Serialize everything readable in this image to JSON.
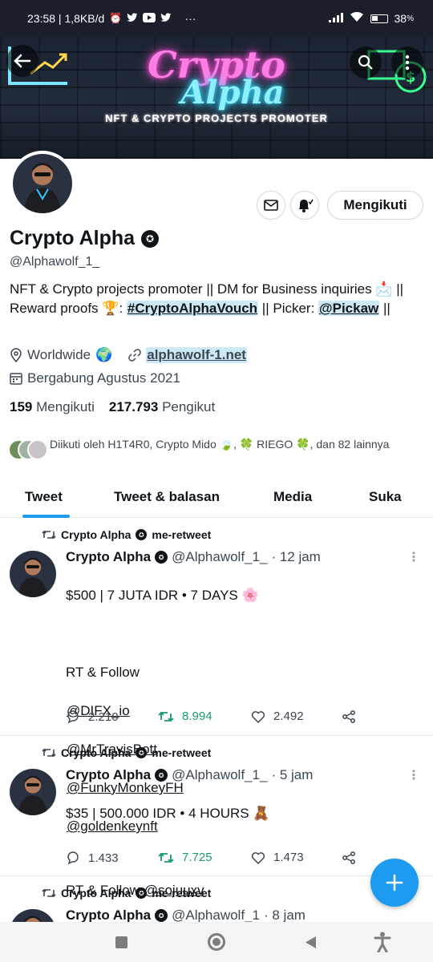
{
  "status_bar": {
    "time_info": "23:58 | 1,8KB/d",
    "more": "···",
    "battery": "38"
  },
  "banner": {
    "title_line1": "Crypto",
    "title_line2": "Alpha",
    "subtitle": "NFT & CRYPTO PROJECTS PROMOTER"
  },
  "profile": {
    "name": "Crypto Alpha",
    "handle": "@Alphawolf_1_",
    "follow_button": "Mengikuti",
    "bio_part1": "NFT & Crypto projects promoter || DM for Business inquiries",
    "bio_emoji1": "📩",
    "bio_part2": "|| Reward proofs",
    "bio_emoji2": "🏆",
    "bio_hashtag": "#CryptoAlphaVouch",
    "bio_part3": "|| Picker:",
    "bio_mention": "@Pickaw",
    "bio_part4": "||",
    "location": "Worldwide",
    "location_emoji": "🌍",
    "website": "alphawolf-1.net",
    "joined": "Bergabung Agustus 2021",
    "following_count": "159",
    "following_label": "Mengikuti",
    "followers_count": "217.793",
    "followers_label": "Pengikut",
    "followed_by": "Diikuti oleh H1T4R0, Crypto Mido 🍃, 🍀 RIEGO 🍀, dan 82 lainnya"
  },
  "tabs": [
    "Tweet",
    "Tweet & balasan",
    "Media",
    "Suka"
  ],
  "tweets": [
    {
      "retweeted_by": "Crypto Alpha",
      "retweet_label": "me-retweet",
      "name": "Crypto Alpha",
      "handle": "@Alphawolf_1_",
      "time": "· 12 jam",
      "line1": "$500 | 7 JUTA IDR • 7 DAYS 🌸",
      "line2": "RT & Follow",
      "mentions": [
        "@DIFX_io",
        "@MrTravisBott",
        "@FunkyMonkeyFH",
        "@goldenkeynft"
      ],
      "replies": "2.210",
      "retweets": "8.994",
      "likes": "2.492"
    },
    {
      "retweeted_by": "Crypto Alpha",
      "retweet_label": "me-retweet",
      "name": "Crypto Alpha",
      "handle": "@Alphawolf_1_",
      "time": "· 5 jam",
      "line1": "$35 | 500.000 IDR • 4 HOURS 🧸",
      "line2": "RT & Follow",
      "mentions": [
        "@sojuuxv"
      ],
      "replies": "1.433",
      "retweets": "7.725",
      "likes": "1.473"
    },
    {
      "retweeted_by": "Crypto Alpha",
      "retweet_label": "me-retweet",
      "name": "Crypto Alpha",
      "handle": "@Alphawolf_1",
      "time": "· 8 jam"
    }
  ],
  "colors": {
    "accent": "#1d9bf0",
    "retweet_green": "#1a9b6c",
    "text": "#0f1419",
    "muted": "#3b4752"
  },
  "icons": [
    "back-arrow-icon",
    "search-icon",
    "more-vert-icon",
    "mail-icon",
    "bell-icon",
    "location-pin-icon",
    "link-icon",
    "calendar-icon",
    "retweet-icon",
    "reply-icon",
    "like-icon",
    "share-icon",
    "compose-plus-icon"
  ]
}
